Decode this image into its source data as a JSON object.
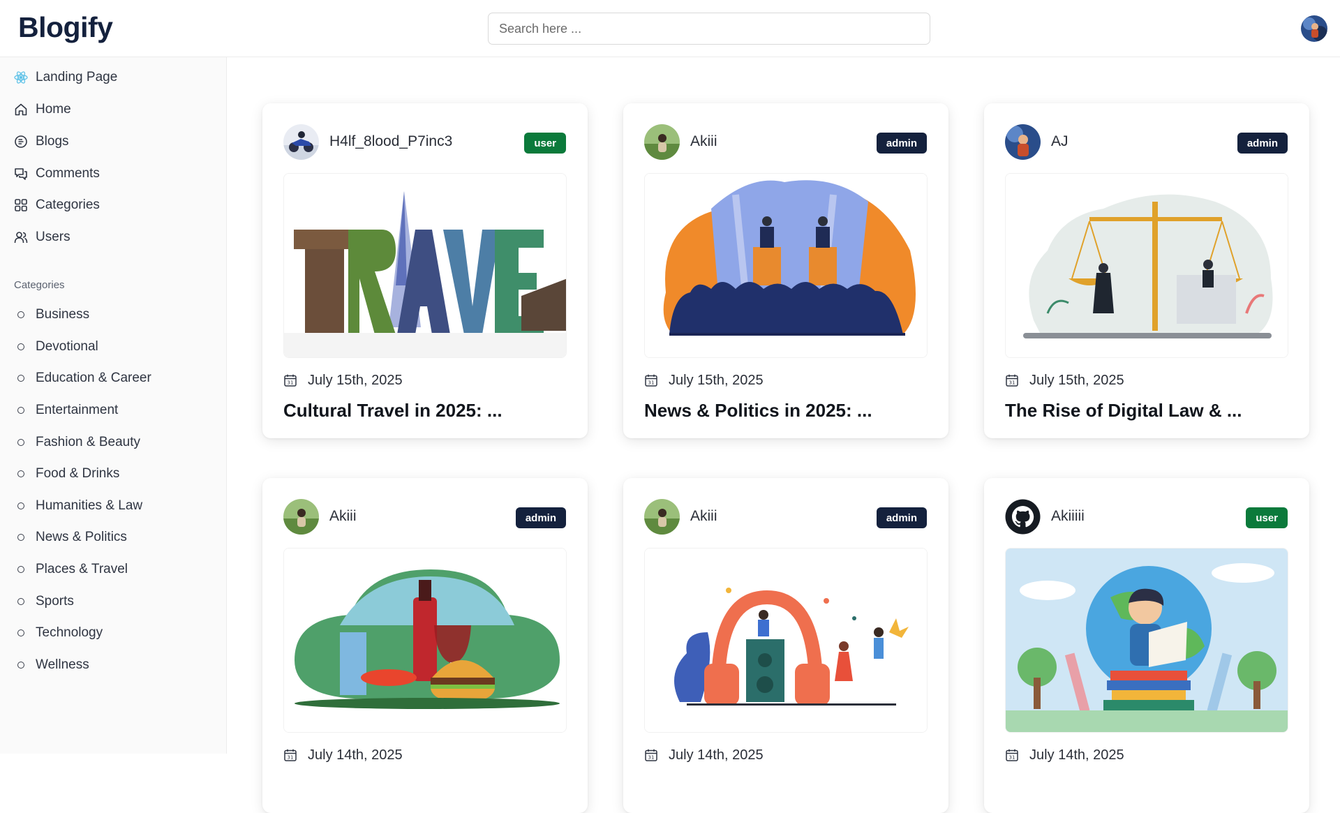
{
  "header": {
    "logo": "Blogify",
    "search_placeholder": "Search here ..."
  },
  "sidebar": {
    "nav": [
      {
        "label": "Landing Page",
        "icon": "react-atom-icon"
      },
      {
        "label": "Home",
        "icon": "home-icon"
      },
      {
        "label": "Blogs",
        "icon": "blogs-icon"
      },
      {
        "label": "Comments",
        "icon": "comments-icon"
      },
      {
        "label": "Categories",
        "icon": "grid-icon"
      },
      {
        "label": "Users",
        "icon": "users-icon"
      }
    ],
    "categories_heading": "Categories",
    "categories": [
      "Business",
      "Devotional",
      "Education & Career",
      "Entertainment",
      "Fashion & Beauty",
      "Food & Drinks",
      "Humanities & Law",
      "News & Politics",
      "Places & Travel",
      "Sports",
      "Technology",
      "Wellness"
    ]
  },
  "posts": [
    {
      "author": "H4lf_8lood_P7inc3",
      "role": "user",
      "date": "July 15th, 2025",
      "title": "Cultural Travel in 2025: ...",
      "image": "travel-illustration"
    },
    {
      "author": "Akiii",
      "role": "admin",
      "date": "July 15th, 2025",
      "title": "News & Politics in 2025: ...",
      "image": "politics-illustration"
    },
    {
      "author": "AJ",
      "role": "admin",
      "date": "July 15th, 2025",
      "title": "The Rise of Digital Law & ...",
      "image": "law-scales-illustration"
    },
    {
      "author": "Akiii",
      "role": "admin",
      "date": "July 14th, 2025",
      "title": "",
      "image": "food-drinks-illustration"
    },
    {
      "author": "Akiii",
      "role": "admin",
      "date": "July 14th, 2025",
      "title": "",
      "image": "music-entertainment-illustration"
    },
    {
      "author": "Akiiiii",
      "role": "user",
      "date": "July 14th, 2025",
      "title": "",
      "image": "education-illustration"
    }
  ],
  "colors": {
    "brand": "#14213d",
    "user_badge": "#0b7a3b",
    "admin_badge": "#14213d"
  }
}
